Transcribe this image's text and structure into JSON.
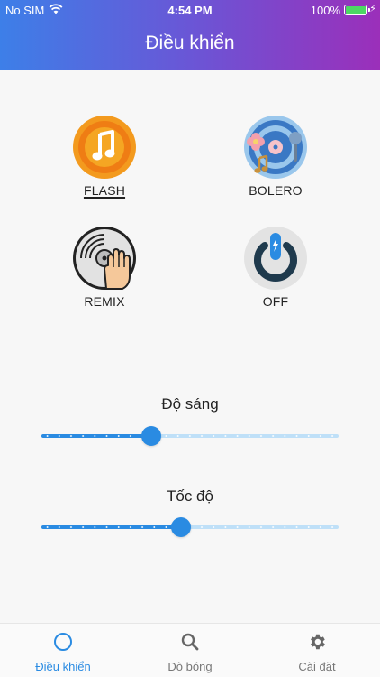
{
  "status_bar": {
    "carrier": "No SIM",
    "time": "4:54 PM",
    "battery_pct": "100%"
  },
  "header": {
    "title": "Điều khiển"
  },
  "modes": [
    {
      "label": "FLASH",
      "icon": "music-note-icon",
      "active": true
    },
    {
      "label": "BOLERO",
      "icon": "vinyl-microphone-icon",
      "active": false
    },
    {
      "label": "REMIX",
      "icon": "turntable-hand-icon",
      "active": false
    },
    {
      "label": "OFF",
      "icon": "power-icon",
      "active": false
    }
  ],
  "sliders": {
    "brightness": {
      "label": "Độ sáng",
      "value_fraction": 0.37
    },
    "speed": {
      "label": "Tốc độ",
      "value_fraction": 0.47
    }
  },
  "bottom_nav": [
    {
      "label": "Điều khiển",
      "icon": "circle-icon",
      "active": true
    },
    {
      "label": "Dò bóng",
      "icon": "search-icon",
      "active": false
    },
    {
      "label": "Cài đặt",
      "icon": "gear-icon",
      "active": false
    }
  ],
  "colors": {
    "accent": "#2a8be2",
    "header_gradient_start": "#3d7fe8",
    "header_gradient_end": "#9b2fba"
  }
}
